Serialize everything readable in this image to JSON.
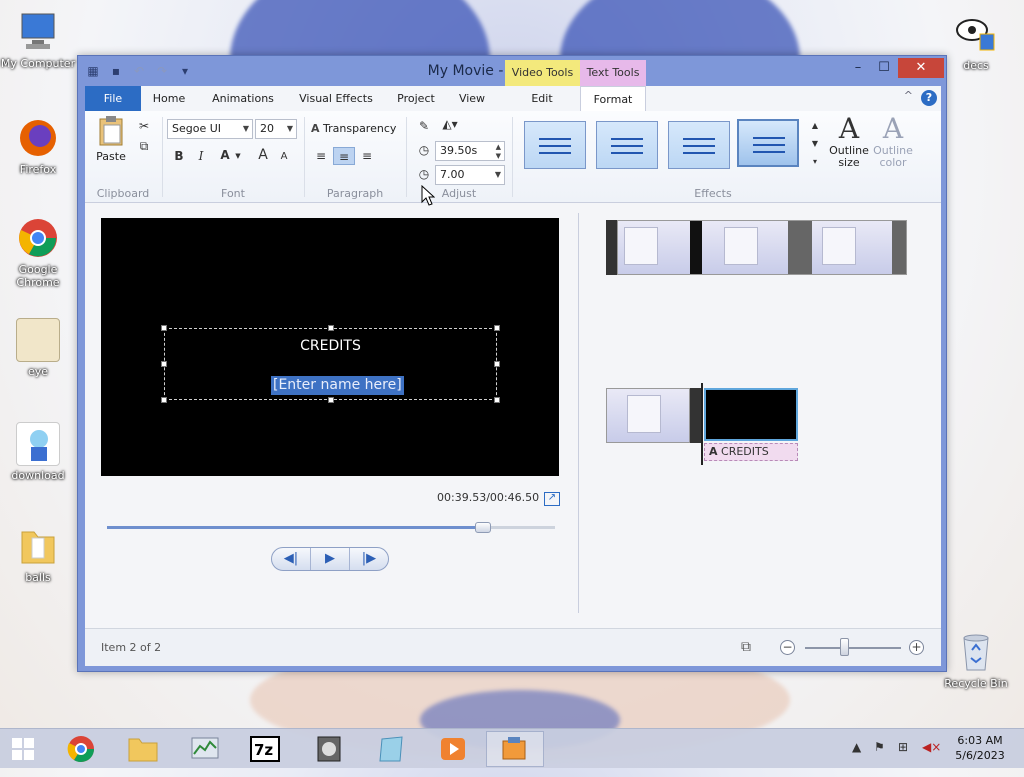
{
  "desktop": {
    "icons": [
      {
        "label": "My Computer"
      },
      {
        "label": "Firefox"
      },
      {
        "label": "Google Chrome"
      },
      {
        "label": "eye"
      },
      {
        "label": "download"
      },
      {
        "label": "balls"
      },
      {
        "label": "decs"
      },
      {
        "label": "Recycle Bin"
      }
    ]
  },
  "window": {
    "title": "My Movie - Movie Maker",
    "context_tabs": {
      "video_tools": "Video Tools",
      "text_tools": "Text Tools"
    },
    "controls": {
      "minimize": "–",
      "maximize": "☐",
      "close": "✕"
    }
  },
  "ribbon": {
    "tabs": [
      {
        "label": "File"
      },
      {
        "label": "Home"
      },
      {
        "label": "Animations"
      },
      {
        "label": "Visual Effects"
      },
      {
        "label": "Project"
      },
      {
        "label": "View"
      },
      {
        "label": "Edit"
      },
      {
        "label": "Format"
      }
    ],
    "help": "?",
    "collapse": "^",
    "clipboard": {
      "paste": "Paste",
      "label": "Clipboard"
    },
    "font": {
      "family": "Segoe UI",
      "size": "20",
      "bold": "B",
      "italic": "I",
      "color": "A",
      "grow": "A",
      "shrink": "A",
      "label": "Font"
    },
    "paragraph": {
      "transparency": "Transparency",
      "label": "Paragraph"
    },
    "adjust": {
      "start_time": "39.50s",
      "duration": "7.00",
      "label": "Adjust"
    },
    "effects": {
      "outline_size": "Outline size",
      "outline_color": "Outline color",
      "label": "Effects"
    }
  },
  "preview": {
    "title_text": "CREDITS",
    "name_text": "[Enter name here]",
    "time_readout": "00:39.53/00:46.50",
    "seek_progress": 0.84
  },
  "storyboard": {
    "caption_label": "CREDITS"
  },
  "status": {
    "item_text": "Item 2 of 2",
    "zoom_level": 0.42
  },
  "taskbar": {
    "time": "6:03 AM",
    "date": "5/6/2023"
  },
  "colors": {
    "file_tab": "#2c6cc4",
    "close_button": "#c7463a",
    "video_tools": "#f3e97c",
    "text_tools": "#e7b9ea"
  }
}
